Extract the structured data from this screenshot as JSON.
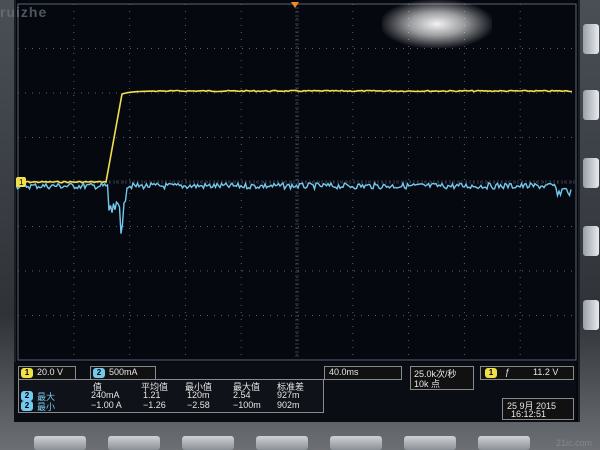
{
  "brand_partial": "ruizhe",
  "watermark": "21ic.com",
  "colors": {
    "ch1": "#f2e04a",
    "ch2": "#74c9ee",
    "grid": "#5a6270"
  },
  "channel_markers": {
    "ch1": "1",
    "ch2": "2"
  },
  "settings": {
    "ch1_scale": "20.0 V",
    "ch2_scale": "500mA",
    "timebase": "40.0ms",
    "sample_rate": "25.0k次/秒",
    "record_length": "10k 点",
    "trigger_source": "1",
    "trigger_slope_symbol": "ƒ",
    "trigger_level": "11.2 V"
  },
  "measurements": {
    "headers": [
      "值",
      "平均值",
      "最小值",
      "最大值",
      "标准差"
    ],
    "rows": [
      {
        "channel": "2",
        "label": "最大",
        "values": [
          "240mA",
          "1.21",
          "120m",
          "2.54",
          "927m"
        ]
      },
      {
        "channel": "2",
        "label": "最小",
        "values": [
          "−1.00 A",
          "−1.26",
          "−2.58",
          "−100m",
          "902m"
        ]
      }
    ]
  },
  "datetime": {
    "date": "25 9月  2015",
    "time": "16:12:51"
  }
}
